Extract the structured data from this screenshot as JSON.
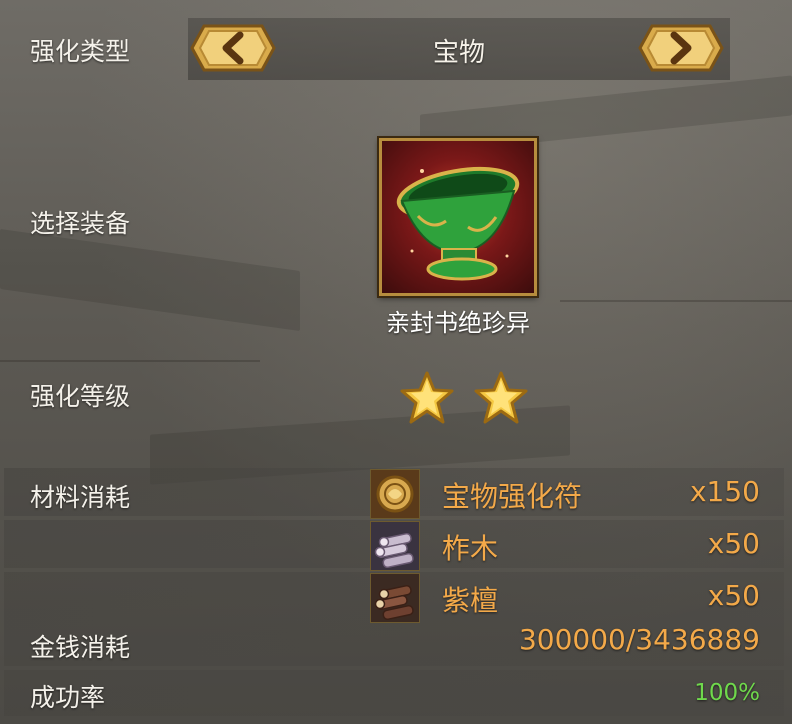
{
  "labels": {
    "enhance_type": "强化类型",
    "select_equipment": "选择装备",
    "enhance_level": "强化等级",
    "material_cost": "材料消耗",
    "money_cost": "金钱消耗",
    "success_rate": "成功率"
  },
  "type_selector": {
    "value": "宝物",
    "prev_icon": "chevron-left-icon",
    "next_icon": "chevron-right-icon"
  },
  "equipment": {
    "name": "亲封书绝珍异",
    "icon": "jade-bowl-icon"
  },
  "enhance_level": {
    "stars": 2
  },
  "materials": [
    {
      "name": "宝物强化符",
      "quantity": "x150",
      "icon": "treasure-talisman-icon"
    },
    {
      "name": "柞木",
      "quantity": "x50",
      "icon": "oak-logs-icon"
    },
    {
      "name": "紫檀",
      "quantity": "x50",
      "icon": "rosewood-logs-icon"
    }
  ],
  "money": "300000/3436889",
  "success_rate": "100%",
  "colors": {
    "accent_orange": "#f3a949",
    "success_green": "#6fd94c",
    "gold_frame": "#b78d3e"
  }
}
